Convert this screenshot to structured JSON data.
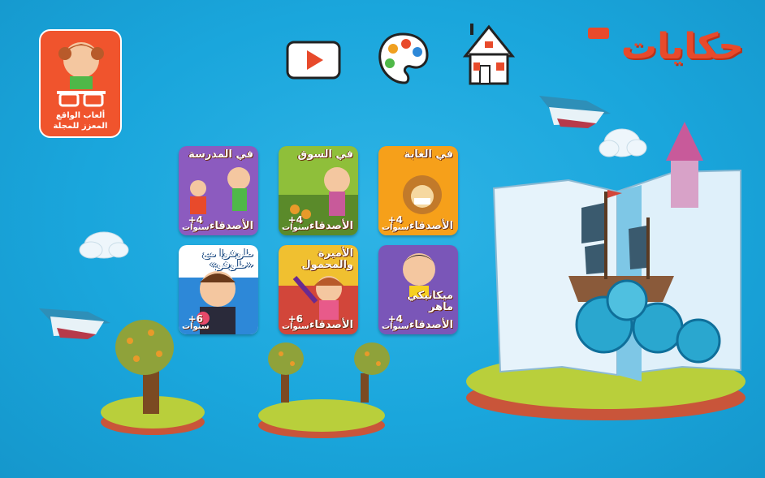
{
  "app": {
    "logo_text": "حكايات"
  },
  "ar_card": {
    "label_line1": "ألعاب الواقع",
    "label_line2": "المعزز للمجلة"
  },
  "toolbar": {
    "video_icon": "play-icon",
    "palette_icon": "palette-icon",
    "home_icon": "house-icon"
  },
  "stories": [
    {
      "title": "في الغابة",
      "subtitle": "الأصدقاء",
      "age": "+4",
      "age_unit": "سنوات",
      "bg": "#f6a01a"
    },
    {
      "title": "في السوق",
      "subtitle": "الأصدقاء",
      "age": "+4",
      "age_unit": "سنوات",
      "bg": "#8fbf3a"
    },
    {
      "title": "في المدرسة",
      "subtitle": "الأصدقاء",
      "age": "+4",
      "age_unit": "سنوات",
      "bg": "#8c5bbf"
    },
    {
      "title": "ميكانيكي ماهر",
      "subtitle": "الأصدقاء",
      "age": "+4",
      "age_unit": "سنوات",
      "bg": "#7a56b8"
    },
    {
      "title": "الأميرة والمحمول",
      "subtitle": "الأصدقاء",
      "age": "+6",
      "age_unit": "سنوات",
      "bg": "#d2463a"
    },
    {
      "title": "طوفوا مع «طوفو»",
      "subtitle": "",
      "age": "+6",
      "age_unit": "سنوات",
      "bg": "#2d88d8"
    }
  ],
  "colors": {
    "background": "#1aa6dc",
    "accent": "#e84a2b",
    "island_grass": "#b9cf3b",
    "island_soil": "#d9553b"
  }
}
